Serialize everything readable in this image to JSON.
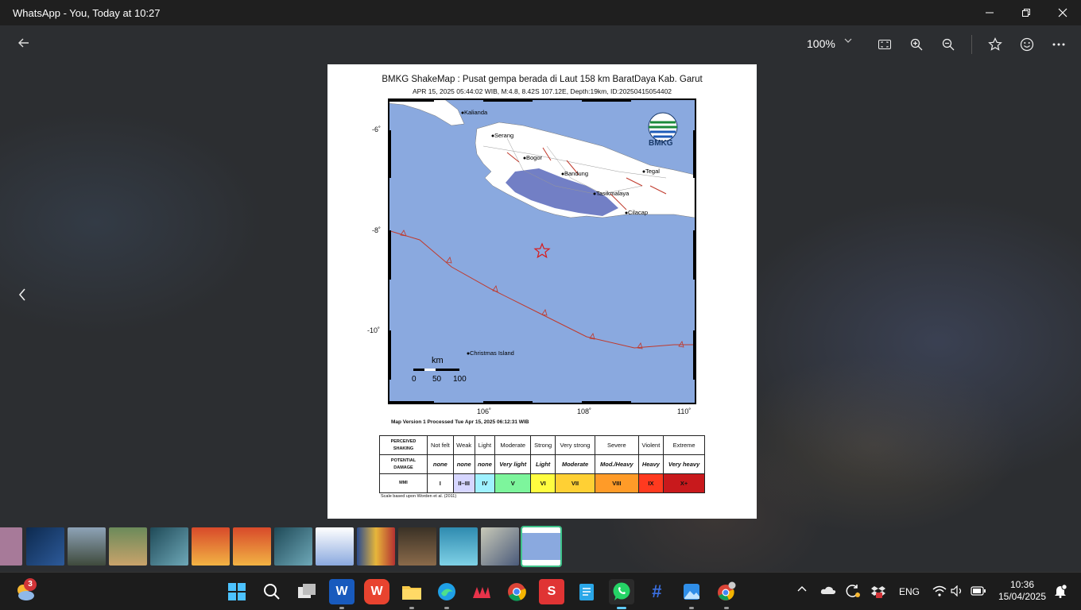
{
  "window": {
    "title": "WhatsApp - You, Today at 10:27"
  },
  "toolbar": {
    "zoom_level": "100%"
  },
  "map": {
    "title": "BMKG ShakeMap : Pusat gempa berada di Laut 158 km BaratDaya Kab. Garut",
    "subtitle": "APR 15, 2025 05:44:02 WIB, M:4.8, 8.42S 107.12E, Depth:19km, ID:20250415054402",
    "logo_text": "BMKG",
    "y_ticks": [
      "-6˚",
      "-8˚",
      "-10˚"
    ],
    "x_ticks": [
      "106˚",
      "108˚",
      "110˚"
    ],
    "places": [
      "Kalianda",
      "Serang",
      "Bogor",
      "Bandung",
      "Tegal",
      "Tasikmalaya",
      "Cilacap",
      "Christmas Island"
    ],
    "scale_unit": "km",
    "scale_ticks": [
      "0",
      "50",
      "100"
    ],
    "version_note": "Map Version 1 Processed Tue Apr 15, 2025 06:12:31 WIB",
    "scale_note": "Scale based upon Worden et al. (2011)",
    "colors": {
      "sea": "#8aa9df",
      "land": "#ffffff",
      "fault": "#c0392b",
      "epicenter": "#d81b1b"
    }
  },
  "intensity_table": {
    "row_heads": [
      "PERCEIVED SHAKING",
      "POTENTIAL DAMAGE",
      "MMI"
    ],
    "shaking": [
      "Not felt",
      "Weak",
      "Light",
      "Moderate",
      "Strong",
      "Very strong",
      "Severe",
      "Violent",
      "Extreme"
    ],
    "damage": [
      "none",
      "none",
      "none",
      "Very light",
      "Light",
      "Moderate",
      "Mod./Heavy",
      "Heavy",
      "Very heavy"
    ],
    "mmi": [
      "I",
      "II–III",
      "IV",
      "V",
      "VI",
      "VII",
      "VIII",
      "IX",
      "X+"
    ],
    "mmi_colors": [
      "#ffffff",
      "#d6d6ff",
      "#9ff1ff",
      "#7df59c",
      "#fffd40",
      "#ffd034",
      "#ff9b28",
      "#ff3a1f",
      "#c8191c"
    ]
  },
  "taskbar": {
    "weather_badge": "3",
    "language": "ENG",
    "time": "10:36",
    "date": "15/04/2025"
  }
}
